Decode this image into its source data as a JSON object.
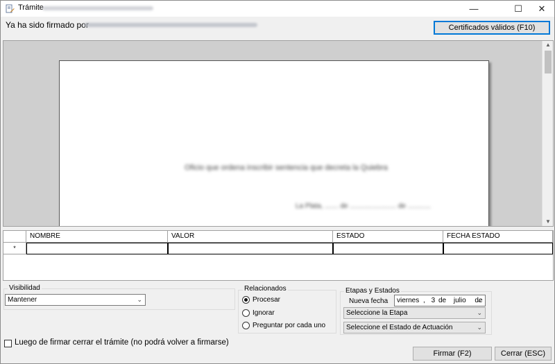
{
  "window": {
    "title": "Trámite",
    "minimize": "—",
    "maximize": "☐",
    "close": "✕"
  },
  "header": {
    "signed_label": "Ya ha sido firmado por",
    "certificates_button": "Certificados válidos (F10)"
  },
  "document": {
    "line1": "Oficio que ordena inscribir sentencia que decreta la Quiebra",
    "line2": "La Plata, ....... de ........................ de ............"
  },
  "grid": {
    "columns": [
      "NOMBRE",
      "VALOR",
      "ESTADO",
      "FECHA ESTADO"
    ],
    "new_row_marker": "*"
  },
  "visibilidad": {
    "legend": "Visibilidad",
    "selected": "Mantener"
  },
  "relacionados": {
    "legend": "Relacionados",
    "options": [
      {
        "label": "Procesar",
        "checked": true
      },
      {
        "label": "Ignorar",
        "checked": false
      },
      {
        "label": "Preguntar por cada uno",
        "checked": false
      }
    ]
  },
  "etapas": {
    "legend": "Etapas y Estados",
    "nueva_fecha_label": "Nueva fecha",
    "date": {
      "weekday": "viernes",
      "sep": ",",
      "day": "3",
      "de1": "de",
      "month": "julio",
      "de2": "de"
    },
    "etapa_placeholder": "Seleccione la Etapa",
    "estado_placeholder": "Seleccione el Estado de Actuación"
  },
  "footer": {
    "close_after_sign_label": "Luego de firmar cerrar el trámite (no podrá volver a firmarse)",
    "close_after_sign_checked": false,
    "sign_button": "Firmar (F2)",
    "cancel_button": "Cerrar (ESC)"
  },
  "icons": {
    "app": "document-pen-icon",
    "dropdown": "chevron-down-icon"
  }
}
